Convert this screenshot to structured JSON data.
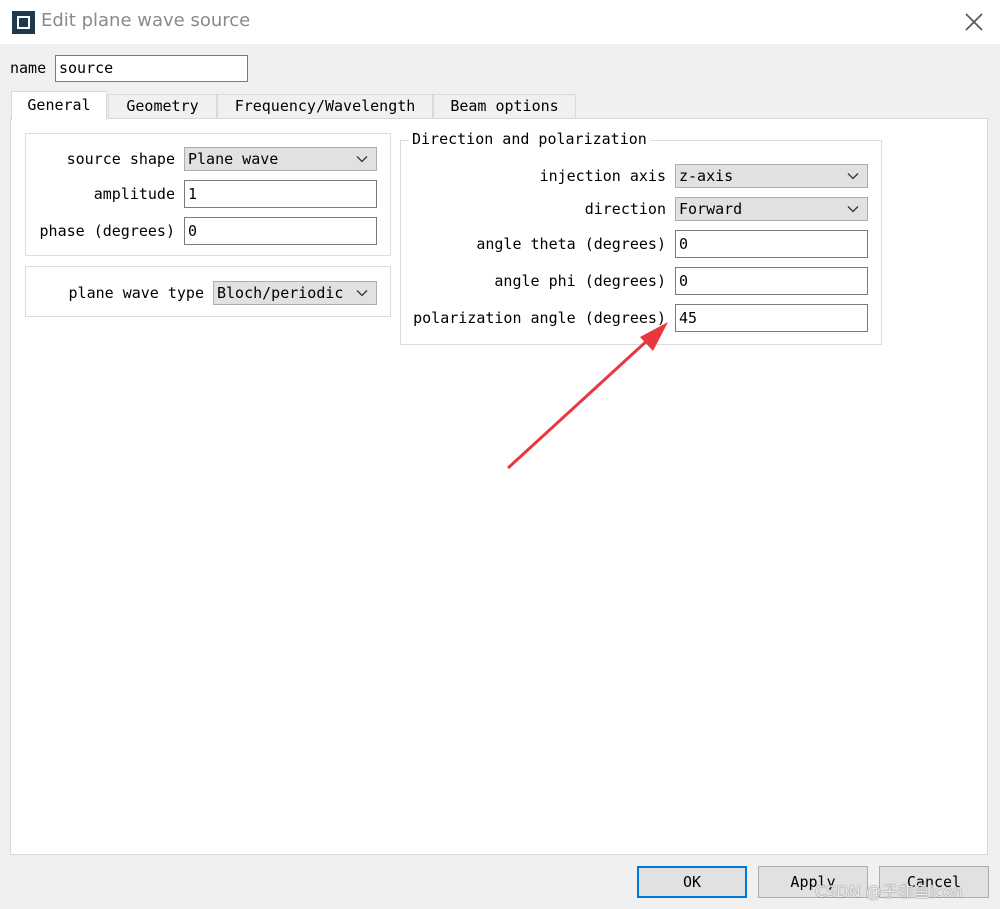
{
  "window": {
    "title": "Edit plane wave source"
  },
  "name_field": {
    "label": "name",
    "value": "source"
  },
  "tabs": [
    {
      "label": "General"
    },
    {
      "label": "Geometry"
    },
    {
      "label": "Frequency/Wavelength"
    },
    {
      "label": "Beam options"
    }
  ],
  "general": {
    "source_shape": {
      "label": "source shape",
      "value": "Plane wave"
    },
    "amplitude": {
      "label": "amplitude",
      "value": "1"
    },
    "phase": {
      "label": "phase (degrees)",
      "value": "0"
    },
    "plane_wave_type": {
      "label": "plane wave type",
      "value": "Bloch/periodic"
    }
  },
  "direction_polarization": {
    "title": "Direction and polarization",
    "injection_axis": {
      "label": "injection axis",
      "value": "z-axis"
    },
    "direction": {
      "label": "direction",
      "value": "Forward"
    },
    "angle_theta": {
      "label": "angle theta (degrees)",
      "value": "0"
    },
    "angle_phi": {
      "label": "angle phi (degrees)",
      "value": "0"
    },
    "polarization_angle": {
      "label": "polarization angle (degrees)",
      "value": "45"
    }
  },
  "buttons": {
    "ok": "OK",
    "apply": "Apply",
    "cancel": "Cancel"
  },
  "watermark": "CSDN @子非鱼icon",
  "colors": {
    "annotation_arrow": "#e8383d",
    "focus_border": "#0078d7"
  }
}
